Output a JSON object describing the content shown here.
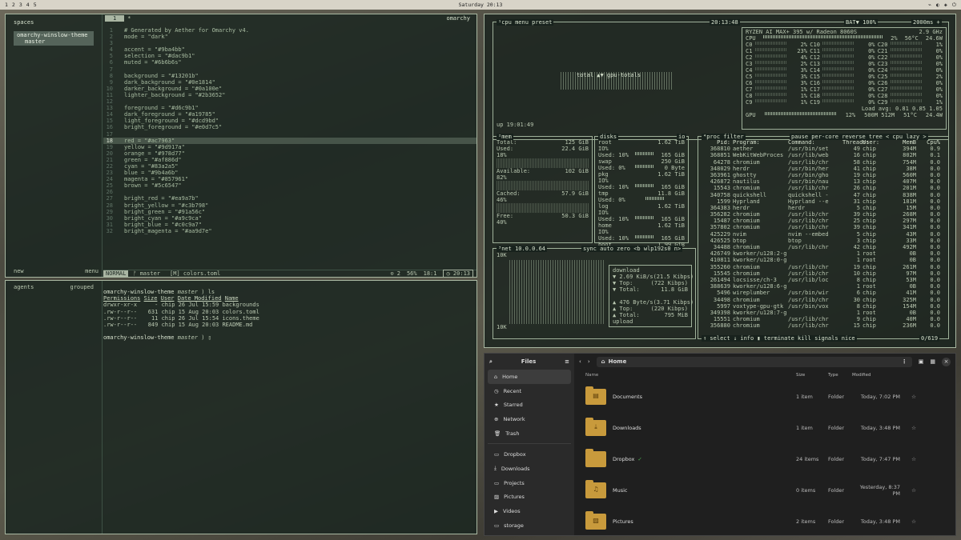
{
  "topbar": {
    "workspaces": [
      "1",
      "2",
      "3",
      "4",
      "5"
    ],
    "clock": "Saturday 20:13",
    "tray": [
      "⌁",
      "◐",
      "◈",
      "⏻"
    ]
  },
  "nvim": {
    "sidebar_title": "spaces",
    "space_name": "omarchy-winslow-theme",
    "space_branch": "master",
    "sidebar_footer_left": "new",
    "sidebar_footer_right": "menu",
    "tab_index": "1",
    "tab_marker": "*",
    "tab_right": "omarchy",
    "lines": [
      {
        "n": "1",
        "t": "# Generated by Aether for Omarchy v4."
      },
      {
        "n": "2",
        "t": "mode = \"dark\""
      },
      {
        "n": "3",
        "t": ""
      },
      {
        "n": "4",
        "t": "accent = \"#9ba4bb\""
      },
      {
        "n": "5",
        "t": "selection = \"#dac9b1\""
      },
      {
        "n": "6",
        "t": "muted = \"#6b6b6s\""
      },
      {
        "n": "7",
        "t": ""
      },
      {
        "n": "8",
        "t": "background = \"#13201b\""
      },
      {
        "n": "9",
        "t": "dark_background = \"#0e1814\""
      },
      {
        "n": "10",
        "t": "darker_background = \"#0a100e\""
      },
      {
        "n": "11",
        "t": "lighter_background = \"#2b3652\""
      },
      {
        "n": "12",
        "t": ""
      },
      {
        "n": "13",
        "t": "foreground = \"#d6c9b1\""
      },
      {
        "n": "14",
        "t": "dark_foreground = \"#a19785\""
      },
      {
        "n": "15",
        "t": "light_foreground = \"#dcd9bd\""
      },
      {
        "n": "16",
        "t": "bright_foreground = \"#e0d7c5\""
      },
      {
        "n": "17",
        "t": ""
      },
      {
        "n": "18",
        "t": "red = \"#ac7963\""
      },
      {
        "n": "19",
        "t": "yellow = \"#9d917a\""
      },
      {
        "n": "20",
        "t": "orange = \"#978d77\""
      },
      {
        "n": "21",
        "t": "green = \"#af886d\""
      },
      {
        "n": "22",
        "t": "cyan = \"#83a2a5\""
      },
      {
        "n": "23",
        "t": "blue = \"#9b4a6b\""
      },
      {
        "n": "24",
        "t": "magenta = \"#857961\""
      },
      {
        "n": "25",
        "t": "brown = \"#5c6547\""
      },
      {
        "n": "26",
        "t": ""
      },
      {
        "n": "27",
        "t": "bright_red = \"#ea9a7b\""
      },
      {
        "n": "28",
        "t": "bright_yellow = \"#c3b798\""
      },
      {
        "n": "29",
        "t": "bright_green = \"#91a56c\""
      },
      {
        "n": "30",
        "t": "bright_cyan = \"#a9c9ca\""
      },
      {
        "n": "31",
        "t": "bright_blue = \"#c0c9a7\""
      },
      {
        "n": "32",
        "t": "bright_magenta = \"#aa9d7e\""
      }
    ],
    "current_line": "18",
    "status": {
      "mode": "NORMAL",
      "branch": "master",
      "file": "[M] colors.toml",
      "diag": "⊙ 2",
      "percent": "56%",
      "pos": "18:1",
      "clock": "20:13"
    }
  },
  "term": {
    "side_left": "agents",
    "side_right": "grouped",
    "prompt_dir": "omarchy-winslow-theme",
    "prompt_branch": "master",
    "cmd": "ls",
    "headers": [
      "Permissions",
      "Size",
      "User",
      "Date Modified",
      "Name"
    ],
    "rows": [
      {
        "perm": "drwxr-xr-x",
        "size": "-",
        "user": "chip",
        "date": "26 Jul 15:59",
        "name": "backgrounds"
      },
      {
        "perm": ".rw-r--r--",
        "size": "631",
        "user": "chip",
        "date": "15 Aug 20:03",
        "name": "colors.toml"
      },
      {
        "perm": ".rw-r--r--",
        "size": "11",
        "user": "chip",
        "date": "26 Jul 15:54",
        "name": "icons.theme"
      },
      {
        "perm": ".rw-r--r--",
        "size": "849",
        "user": "chip",
        "date": "15 Aug 20:03",
        "name": "README.md"
      }
    ]
  },
  "btop": {
    "top": {
      "tabs": "¹cpu  menu  preset",
      "clock": "20:13:48",
      "bat": "BAT▼ 100%",
      "freq": "2000ms +",
      "cpu_name": "RYZEN AI MAX+ 395 w/ Radeon 8060S",
      "ghz": "2.9 GHz",
      "graph_label": "total ▲▼ gpu-totals",
      "uptime": "up 19:01:49",
      "cpu_total": {
        "label": "CPU",
        "pct": "2%",
        "temp": "56°C",
        "w": "24.6W"
      },
      "cores": [
        [
          "C0",
          "2%",
          "C10",
          "0%",
          "C20",
          "1%"
        ],
        [
          "C1",
          "23%",
          "C11",
          "0%",
          "C21",
          "0%"
        ],
        [
          "C2",
          "4%",
          "C12",
          "0%",
          "C22",
          "0%"
        ],
        [
          "C3",
          "2%",
          "C13",
          "0%",
          "C23",
          "0%"
        ],
        [
          "C4",
          "3%",
          "C14",
          "0%",
          "C24",
          "0%"
        ],
        [
          "C5",
          "3%",
          "C15",
          "0%",
          "C25",
          "2%"
        ],
        [
          "C6",
          "3%",
          "C16",
          "0%",
          "C26",
          "0%"
        ],
        [
          "C7",
          "1%",
          "C17",
          "0%",
          "C27",
          "0%"
        ],
        [
          "C8",
          "1%",
          "C18",
          "0%",
          "C28",
          "0%"
        ],
        [
          "C9",
          "1%",
          "C19",
          "0%",
          "C29",
          "1%"
        ]
      ],
      "load": "Load avg: 0.81  0.85  1.05",
      "gpu": {
        "label": "GPU",
        "pct": "12%",
        "mem": "500M 512M",
        "temp": "51°C",
        "w": "24.4W"
      }
    },
    "mem": {
      "title": "²mem",
      "total": "Total:",
      "total_v": "125 GiB",
      "used": "Used:",
      "used_v": "22.4 GiB",
      "used_p": "18%",
      "avail": "Available:",
      "avail_v": "102 GiB",
      "avail_p": "82%",
      "cached": "Cached:",
      "cached_v": "57.9 GiB",
      "cached_p": "46%",
      "free": "Free:",
      "free_v": "50.3 GiB",
      "free_p": "40%"
    },
    "disks": {
      "title": "disks",
      "io": "io",
      "items": [
        {
          "name": "root",
          "total": "1.62 TiB",
          "io": "IO%",
          "used": "Used: 10%",
          "used_v": "165 GiB"
        },
        {
          "name": "swap",
          "total": "250 GiB",
          "io": "",
          "used": "Used:  0%",
          "used_v": "0 Byte"
        },
        {
          "name": "pkg",
          "total": "1.62 TiB",
          "io": "IO%",
          "used": "Used: 10%",
          "used_v": "165 GiB"
        },
        {
          "name": "tmp",
          "total": "11.8 GiB",
          "io": "",
          "used": "Used:  0%",
          "used_v": ""
        },
        {
          "name": "log",
          "total": "1.62 TiB",
          "io": "IO%",
          "used": "Used: 10%",
          "used_v": "165 GiB"
        },
        {
          "name": "home",
          "total": "1.62 TiB",
          "io": "IO%",
          "used": "Used: 10%",
          "used_v": "165 GiB"
        },
        {
          "name": "boot",
          "total": "1.99 GiB",
          "io": "",
          "used": "",
          "used_v": ""
        }
      ]
    },
    "proc": {
      "title": "⁴proc  filter",
      "tabs": "pause  per-core  reverse  tree  < cpu lazy >",
      "headers": [
        "Pid:",
        "Program:",
        "Command:",
        "Threads:",
        "User:",
        "MemB",
        "Cpu%"
      ],
      "rows": [
        [
          "368810",
          "aether",
          "/usr/bin/set",
          "49",
          "chip",
          "394M",
          "0.9"
        ],
        [
          "368851",
          "WebKitWebProces",
          "/usr/lib/web",
          "16",
          "chip",
          "802M",
          "0.1"
        ],
        [
          "64278",
          "chromium",
          "/usr/lib/chr",
          "58",
          "chip",
          "754M",
          "0.0"
        ],
        [
          "348029",
          "herdr",
          "/usr/bin/her",
          "41",
          "chip",
          "38M",
          "0.0"
        ],
        [
          "363961",
          "ghostty",
          "/usr/bin/gho",
          "19",
          "chip",
          "560M",
          "0.0"
        ],
        [
          "426872",
          "nautilus",
          "/usr/bin/nau",
          "13",
          "chip",
          "407M",
          "0.0"
        ],
        [
          "15543",
          "chromium",
          "/usr/lib/chr",
          "26",
          "chip",
          "201M",
          "0.0"
        ],
        [
          "340758",
          "quickshell",
          "quickshell -",
          "47",
          "chip",
          "838M",
          "0.0"
        ],
        [
          "1599",
          "Hyprland",
          "Hyprland --e",
          "31",
          "chip",
          "181M",
          "0.0"
        ],
        [
          "364383",
          "herdr",
          "herdr",
          "5",
          "chip",
          "15M",
          "0.0"
        ],
        [
          "356282",
          "chromium",
          "/usr/lib/chr",
          "39",
          "chip",
          "268M",
          "0.0"
        ],
        [
          "15487",
          "chromium",
          "/usr/lib/chr",
          "25",
          "chip",
          "297M",
          "0.0"
        ],
        [
          "357802",
          "chromium",
          "/usr/lib/chr",
          "39",
          "chip",
          "341M",
          "0.0"
        ],
        [
          "425229",
          "nvim",
          "nvim --embed",
          "5",
          "chip",
          "43M",
          "0.0"
        ],
        [
          "426525",
          "btop",
          "btop",
          "3",
          "chip",
          "33M",
          "0.0"
        ],
        [
          "34488",
          "chromium",
          "/usr/lib/chr",
          "42",
          "chip",
          "492M",
          "0.0"
        ],
        [
          "426749",
          "kworker/u128:2-g",
          "",
          "1",
          "root",
          "0B",
          "0.0"
        ],
        [
          "410811",
          "kworker/u128:0-g",
          "",
          "1",
          "root",
          "0B",
          "0.0"
        ],
        [
          "355260",
          "chromium",
          "/usr/lib/chr",
          "19",
          "chip",
          "261M",
          "0.0"
        ],
        [
          "15545",
          "chromium",
          "/usr/lib/chr",
          "10",
          "chip",
          "97M",
          "0.0"
        ],
        [
          "261494",
          "locsisse/ch-3",
          "/usr/lib/loc",
          "8",
          "chip",
          "53M",
          "0.0"
        ],
        [
          "388639",
          "kworker/u128:6-g",
          "",
          "1",
          "root",
          "0B",
          "0.0"
        ],
        [
          "5496",
          "wireplumber",
          "/usr/bin/wir",
          "6",
          "chip",
          "41M",
          "0.0"
        ],
        [
          "34498",
          "chromium",
          "/usr/lib/chr",
          "30",
          "chip",
          "325M",
          "0.0"
        ],
        [
          "5997",
          "voxtype-gpu-gtk",
          "/usr/bin/vox",
          "8",
          "chip",
          "154M",
          "0.0"
        ],
        [
          "349398",
          "kworker/u128:7-g",
          "",
          "1",
          "root",
          "0B",
          "0.0"
        ],
        [
          "15551",
          "chromium",
          "/usr/lib/chr",
          "9",
          "chip",
          "40M",
          "0.0"
        ],
        [
          "356880",
          "chromium",
          "/usr/lib/chr",
          "15",
          "chip",
          "236M",
          "0.0"
        ]
      ],
      "foot": "↑ select ↓  info  ▮ terminate  kill  signals  nice",
      "count": "0/619"
    },
    "net": {
      "title": "³net",
      "iface": "10.0.0.64",
      "tabs": "sync  auto  zero  <b wlp192s0 n>",
      "top_scale": "10K",
      "bot_scale": "10K",
      "download": "download",
      "dl_rate": "▼ 2.69 KiB/s",
      "dl_kbps": "(21.5 Kibps)",
      "dl_top": "▼ Top:",
      "dl_top_v": "(722 Kibps)",
      "dl_total": "▼ Total:",
      "dl_total_v": "11.8 GiB",
      "ul_rate": "▲ 476 Byte/s",
      "ul_kbps": "(3.71 Kibps)",
      "ul_top": "▲ Top:",
      "ul_top_v": "(220 Kibps)",
      "ul_total": "▲ Total:",
      "ul_total_v": "795 MiB",
      "upload": "upload"
    }
  },
  "files": {
    "title": "Files",
    "path": "Home",
    "side_items": [
      {
        "icon": "⌂",
        "label": "Home",
        "sel": true
      },
      {
        "icon": "◷",
        "label": "Recent"
      },
      {
        "icon": "★",
        "label": "Starred"
      },
      {
        "icon": "⊕",
        "label": "Network"
      },
      {
        "icon": "🗑",
        "label": "Trash"
      }
    ],
    "side_items2": [
      {
        "icon": "▭",
        "label": "Dropbox"
      },
      {
        "icon": "⤓",
        "label": "Downloads"
      },
      {
        "icon": "▭",
        "label": "Projects"
      },
      {
        "icon": "▨",
        "label": "Pictures"
      },
      {
        "icon": "▶",
        "label": "Videos"
      },
      {
        "icon": "▭",
        "label": "storage"
      }
    ],
    "columns": [
      "Name",
      "Size",
      "Type",
      "Modified"
    ],
    "rows": [
      {
        "icon": "▤",
        "name": "Documents",
        "size": "1 item",
        "type": "Folder",
        "mod": "Today, 7:02 PM"
      },
      {
        "icon": "⤓",
        "name": "Downloads",
        "size": "1 item",
        "type": "Folder",
        "mod": "Today, 3:48 PM"
      },
      {
        "icon": "",
        "name": "Dropbox",
        "badge": "✓",
        "size": "24 items",
        "type": "Folder",
        "mod": "Today, 7:47 PM"
      },
      {
        "icon": "♫",
        "name": "Music",
        "size": "0 items",
        "type": "Folder",
        "mod": "Yesterday, 8:37 PM"
      },
      {
        "icon": "▨",
        "name": "Pictures",
        "size": "2 items",
        "type": "Folder",
        "mod": "Today, 3:48 PM"
      }
    ]
  }
}
